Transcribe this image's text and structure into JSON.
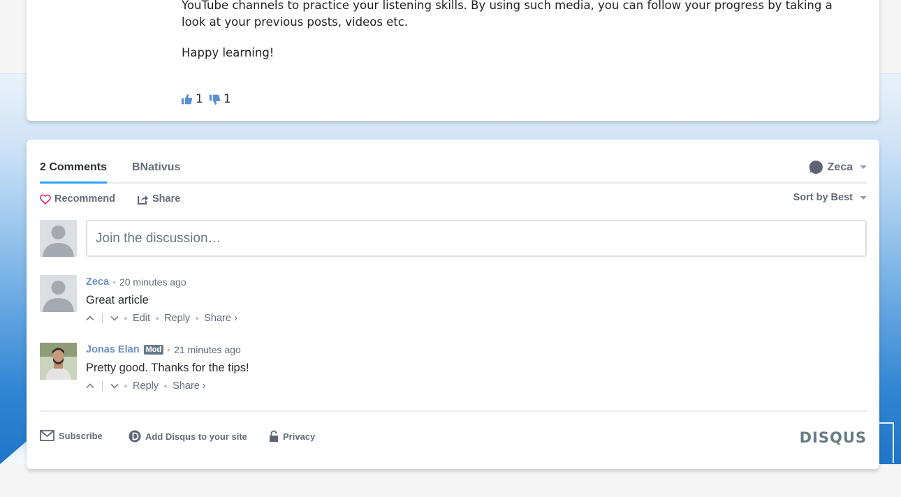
{
  "article": {
    "paragraph_1": "YouTube channels to practice your listening skills. By using such media, you can follow your progress by taking a look at your previous posts, videos etc.",
    "paragraph_2": "Happy learning!",
    "likes": "1",
    "dislikes": "1"
  },
  "disqus": {
    "tabs": {
      "comments": "2 Comments",
      "site": "BNativus"
    },
    "user_menu": {
      "name": "Zeca"
    },
    "actions": {
      "recommend": "Recommend",
      "share": "Share",
      "sort": "Sort by Best"
    },
    "composer": {
      "placeholder": "Join the discussion…"
    },
    "comments": [
      {
        "author": "Zeca",
        "time": "20 minutes ago",
        "body": "Great article",
        "actions": [
          "Edit",
          "Reply",
          "Share ›"
        ]
      },
      {
        "author": "Jonas Elan",
        "badge": "Mod",
        "time": "21 minutes ago",
        "body": "Pretty good. Thanks for the tips!",
        "actions": [
          "Reply",
          "Share ›"
        ]
      }
    ],
    "footer": {
      "subscribe": "Subscribe",
      "add_disqus": "Add Disqus to your site",
      "privacy": "Privacy",
      "logo": "DISQUS"
    }
  },
  "colors": {
    "accent_blue": "#2e9fff",
    "author_link": "#6a8fc9",
    "text_muted": "#656c7a",
    "heart": "#e0245e"
  },
  "icons": [
    "thumbs-up-icon",
    "thumbs-down-icon",
    "chat-bubble-icon",
    "heart-icon",
    "share-icon",
    "upvote-icon",
    "downvote-icon",
    "envelope-icon",
    "disqus-d-icon",
    "lock-icon"
  ]
}
